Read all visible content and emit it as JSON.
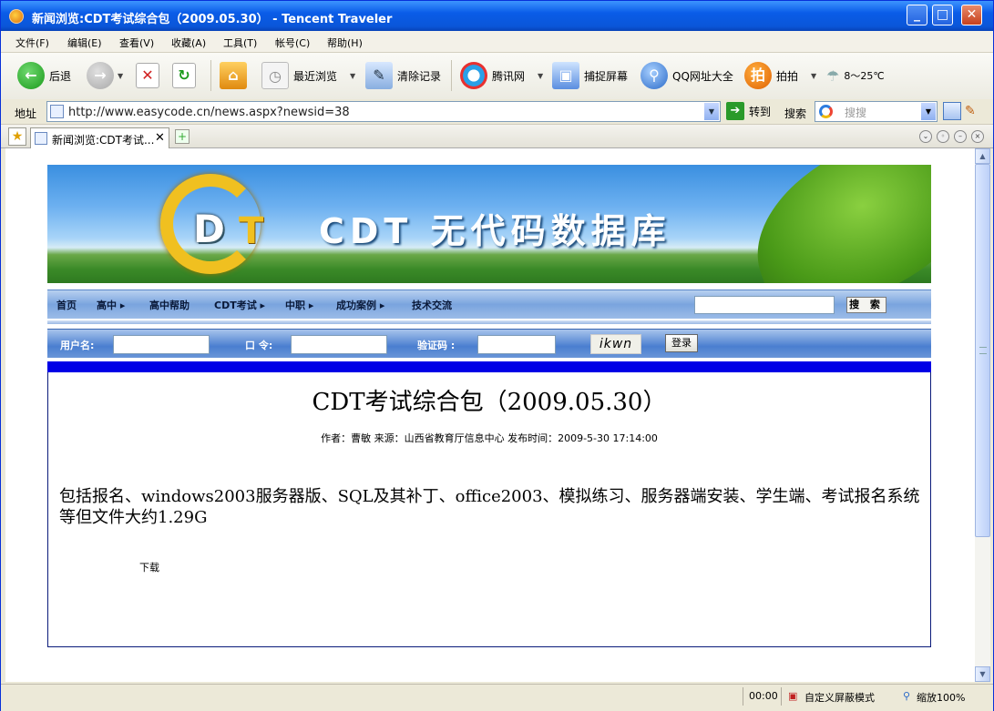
{
  "window": {
    "title": "新闻浏览:CDT考试综合包（2009.05.30） - Tencent Traveler",
    "min": "_",
    "max": "□",
    "close": "✕"
  },
  "menu": [
    "文件(F)",
    "编辑(E)",
    "查看(V)",
    "收藏(A)",
    "工具(T)",
    "帐号(C)",
    "帮助(H)"
  ],
  "toolbar": {
    "back": "后退",
    "recent": "最近浏览",
    "clear": "清除记录",
    "tencent": "腾讯网",
    "capture": "捕捉屏幕",
    "qq_nav": "QQ网址大全",
    "paipai": "拍拍",
    "weather": "8～25℃"
  },
  "address": {
    "label": "地址",
    "url": "http://www.easycode.cn/news.aspx?newsid=38",
    "go": "转到",
    "search_label": "搜索",
    "search_placeholder": "搜搜"
  },
  "tabs": [
    {
      "label": "新闻浏览:CDT考试...",
      "close": "✕"
    }
  ],
  "page": {
    "banner_title": "CDT 无代码数据库",
    "logo_d": "D",
    "logo_t": "T",
    "nav": [
      "首页",
      "高中 ▸",
      "高中帮助",
      "CDT考试 ▸",
      "中职 ▸",
      "成功案例 ▸",
      "技术交流"
    ],
    "search_button": "搜 索",
    "login": {
      "username_label": "用户名:",
      "password_label": "口  令:",
      "captcha_label": "验证码 :",
      "captcha_text": "ikwn",
      "login_button": "登录"
    },
    "article": {
      "title": "CDT考试综合包（2009.05.30）",
      "meta": "作者：曹敏  来源：山西省教育厅信息中心  发布时间：2009-5-30 17:14:00",
      "body": "包括报名、windows2003服务器版、SQL及其补丁、office2003、模拟练习、服务器端安装、学生端、考试报名系统等但文件大约1.29G",
      "download": "下载"
    }
  },
  "status": {
    "time": "00:00",
    "mode": "自定义屏蔽模式",
    "zoom": "缩放100%"
  },
  "colors": {
    "title_bar": "#0a5ce8",
    "nav_bar": "#7aa4de",
    "article_bar": "#0000e6"
  }
}
